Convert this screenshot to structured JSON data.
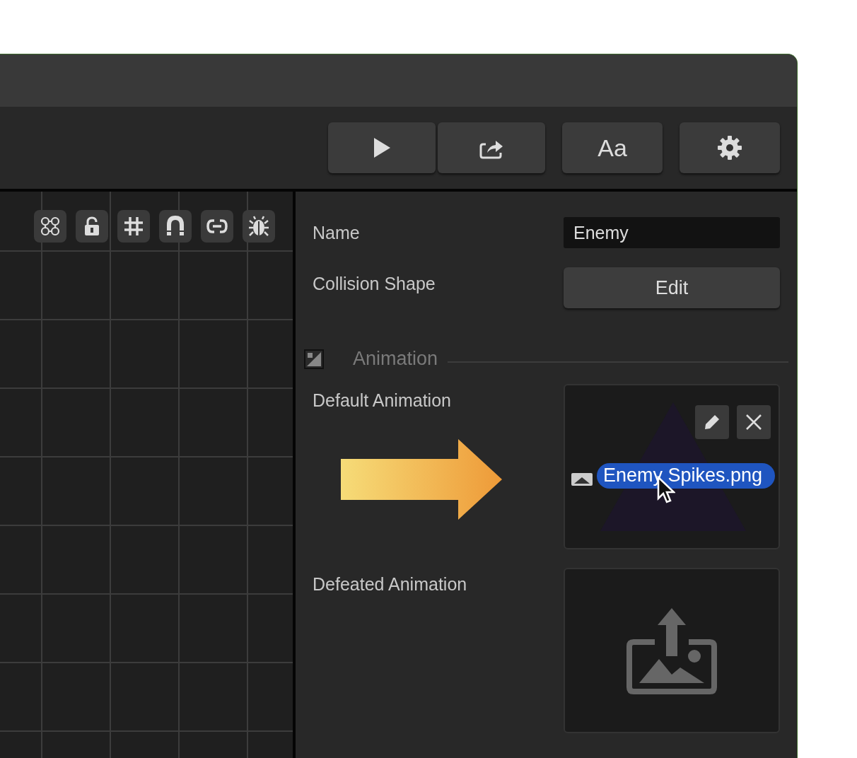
{
  "toolbar": {
    "buttons": [
      {
        "kind": "play"
      },
      {
        "kind": "export"
      },
      {
        "kind": "text",
        "label": "Aa"
      },
      {
        "kind": "settings"
      }
    ]
  },
  "canvas": {
    "tools": [
      {
        "kind": "nodes"
      },
      {
        "kind": "lock"
      },
      {
        "kind": "grid"
      },
      {
        "kind": "magnet"
      },
      {
        "kind": "link"
      },
      {
        "kind": "bug"
      }
    ]
  },
  "inspector": {
    "name": {
      "label": "Name",
      "value": "Enemy"
    },
    "collision_shape": {
      "label": "Collision Shape",
      "button": "Edit"
    },
    "section": {
      "title": "Animation"
    },
    "animations": [
      {
        "label": "Default Animation",
        "kind": "file",
        "file": "Enemy Spikes.png"
      },
      {
        "label": "Defeated Animation",
        "kind": "empty"
      }
    ]
  }
}
